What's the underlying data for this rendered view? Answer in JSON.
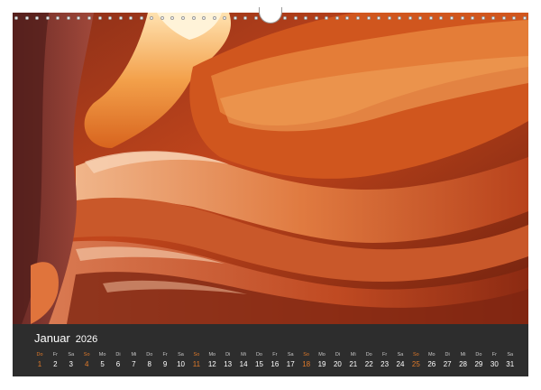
{
  "colors": {
    "accent": "#e07a2a",
    "strip": "#2d2d2d",
    "text": "#ffffff",
    "muted": "#c8c8c8"
  },
  "photo": {
    "icon": "canyon-photo"
  },
  "calendar": {
    "month": "Januar",
    "year": "2026",
    "days": [
      {
        "wd": "Do",
        "d": "1",
        "weekend": true
      },
      {
        "wd": "Fr",
        "d": "2",
        "weekend": false
      },
      {
        "wd": "Sa",
        "d": "3",
        "weekend": false
      },
      {
        "wd": "So",
        "d": "4",
        "weekend": true
      },
      {
        "wd": "Mo",
        "d": "5",
        "weekend": false
      },
      {
        "wd": "Di",
        "d": "6",
        "weekend": false
      },
      {
        "wd": "Mi",
        "d": "7",
        "weekend": false
      },
      {
        "wd": "Do",
        "d": "8",
        "weekend": false
      },
      {
        "wd": "Fr",
        "d": "9",
        "weekend": false
      },
      {
        "wd": "Sa",
        "d": "10",
        "weekend": false
      },
      {
        "wd": "So",
        "d": "11",
        "weekend": true
      },
      {
        "wd": "Mo",
        "d": "12",
        "weekend": false
      },
      {
        "wd": "Di",
        "d": "13",
        "weekend": false
      },
      {
        "wd": "Mi",
        "d": "14",
        "weekend": false
      },
      {
        "wd": "Do",
        "d": "15",
        "weekend": false
      },
      {
        "wd": "Fr",
        "d": "16",
        "weekend": false
      },
      {
        "wd": "Sa",
        "d": "17",
        "weekend": false
      },
      {
        "wd": "So",
        "d": "18",
        "weekend": true
      },
      {
        "wd": "Mo",
        "d": "19",
        "weekend": false
      },
      {
        "wd": "Di",
        "d": "20",
        "weekend": false
      },
      {
        "wd": "Mi",
        "d": "21",
        "weekend": false
      },
      {
        "wd": "Do",
        "d": "22",
        "weekend": false
      },
      {
        "wd": "Fr",
        "d": "23",
        "weekend": false
      },
      {
        "wd": "Sa",
        "d": "24",
        "weekend": false
      },
      {
        "wd": "So",
        "d": "25",
        "weekend": true
      },
      {
        "wd": "Mo",
        "d": "26",
        "weekend": false
      },
      {
        "wd": "Di",
        "d": "27",
        "weekend": false
      },
      {
        "wd": "Mi",
        "d": "28",
        "weekend": false
      },
      {
        "wd": "Do",
        "d": "29",
        "weekend": false
      },
      {
        "wd": "Fr",
        "d": "30",
        "weekend": false
      },
      {
        "wd": "Sa",
        "d": "31",
        "weekend": false
      }
    ]
  }
}
